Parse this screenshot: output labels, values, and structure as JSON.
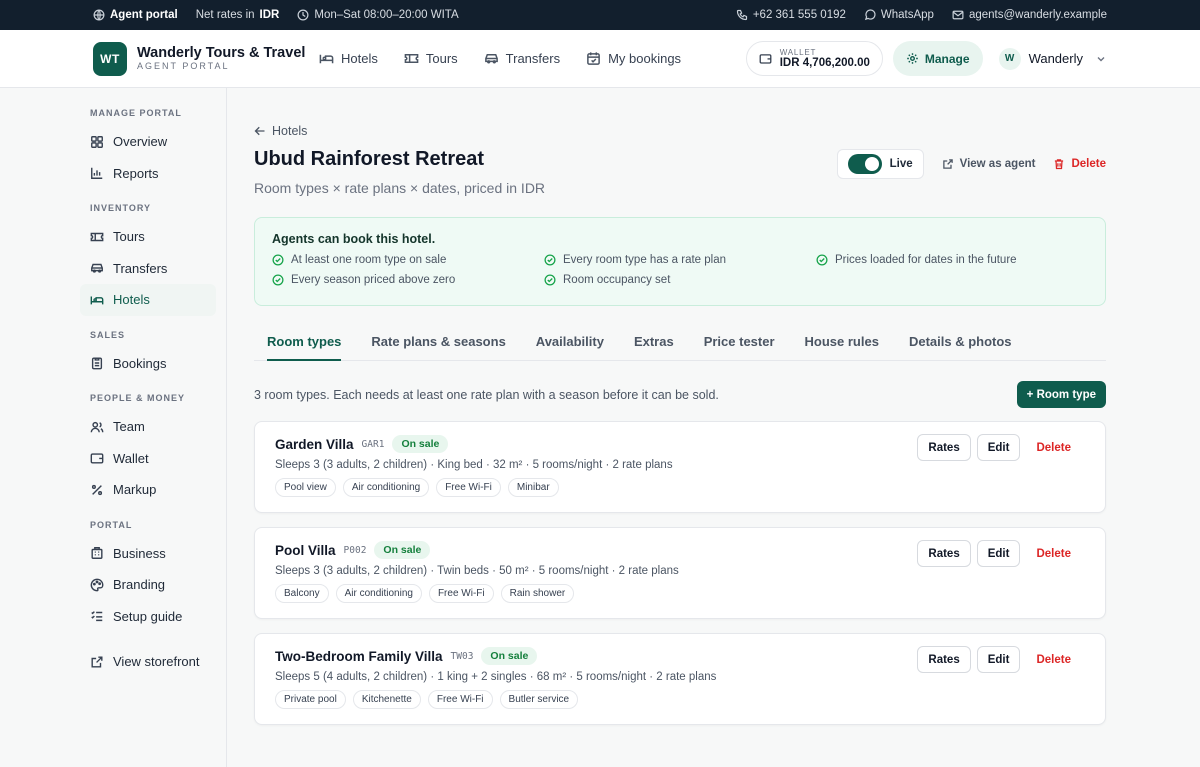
{
  "topbar": {
    "portal": "Agent portal",
    "rates_prefix": "Net rates in",
    "rates_currency": "IDR",
    "hours": "Mon–Sat 08:00–20:00 WITA",
    "phone": "+62 361 555 0192",
    "whatsapp": "WhatsApp",
    "email": "agents@wanderly.example"
  },
  "header": {
    "logo": "WT",
    "brand": "Wanderly Tours & Travel",
    "brand_sub": "AGENT PORTAL",
    "nav": [
      "Hotels",
      "Tours",
      "Transfers",
      "My bookings"
    ],
    "wallet_label": "WALLET",
    "wallet_amount": "IDR 4,706,200.00",
    "manage": "Manage",
    "avatar": "W",
    "user": "Wanderly"
  },
  "sidebar": {
    "manage_portal": "MANAGE PORTAL",
    "overview": "Overview",
    "reports": "Reports",
    "inventory": "INVENTORY",
    "tours": "Tours",
    "transfers": "Transfers",
    "hotels": "Hotels",
    "sales": "SALES",
    "bookings": "Bookings",
    "people_money": "PEOPLE & MONEY",
    "team": "Team",
    "wallet": "Wallet",
    "markup": "Markup",
    "portal": "PORTAL",
    "business": "Business",
    "branding": "Branding",
    "setup_guide": "Setup guide",
    "view_storefront": "View storefront"
  },
  "page": {
    "back": "Hotels",
    "title": "Ubud Rainforest Retreat",
    "subtitle": "Room types × rate plans × dates, priced in IDR",
    "live": "Live",
    "view_as_agent": "View as agent",
    "delete": "Delete"
  },
  "readiness": {
    "heading": "Agents can book this hotel.",
    "checks": [
      "At least one room type on sale",
      "Every room type has a rate plan",
      "Prices loaded for dates in the future",
      "Every season priced above zero",
      "Room occupancy set"
    ]
  },
  "tabs": [
    "Room types",
    "Rate plans & seasons",
    "Availability",
    "Extras",
    "Price tester",
    "House rules",
    "Details & photos"
  ],
  "toolbar": {
    "description": "3 room types. Each needs at least one rate plan with a season before it can be sold.",
    "add": "+ Room type"
  },
  "room_types": [
    {
      "name": "Garden Villa",
      "code": "GAR1",
      "status": "On sale",
      "meta": "Sleeps 3 (3 adults, 2 children) · King bed · 32 m² · 5 rooms/night · 2 rate plans",
      "tags": [
        "Pool view",
        "Air conditioning",
        "Free Wi-Fi",
        "Minibar"
      ]
    },
    {
      "name": "Pool Villa",
      "code": "P002",
      "status": "On sale",
      "meta": "Sleeps 3 (3 adults, 2 children) · Twin beds · 50 m² · 5 rooms/night · 2 rate plans",
      "tags": [
        "Balcony",
        "Air conditioning",
        "Free Wi-Fi",
        "Rain shower"
      ]
    },
    {
      "name": "Two-Bedroom Family Villa",
      "code": "TW03",
      "status": "On sale",
      "meta": "Sleeps 5 (4 adults, 2 children) · 1 king + 2 singles · 68 m² · 5 rooms/night · 2 rate plans",
      "tags": [
        "Private pool",
        "Kitchenette",
        "Free Wi-Fi",
        "Butler service"
      ]
    }
  ],
  "card_actions": {
    "rates": "Rates",
    "edit": "Edit",
    "delete": "Delete"
  },
  "colors": {
    "brand": "#0f5c4d",
    "topbar": "#121f2d",
    "danger": "#dc2626",
    "success": "#16a34a"
  }
}
